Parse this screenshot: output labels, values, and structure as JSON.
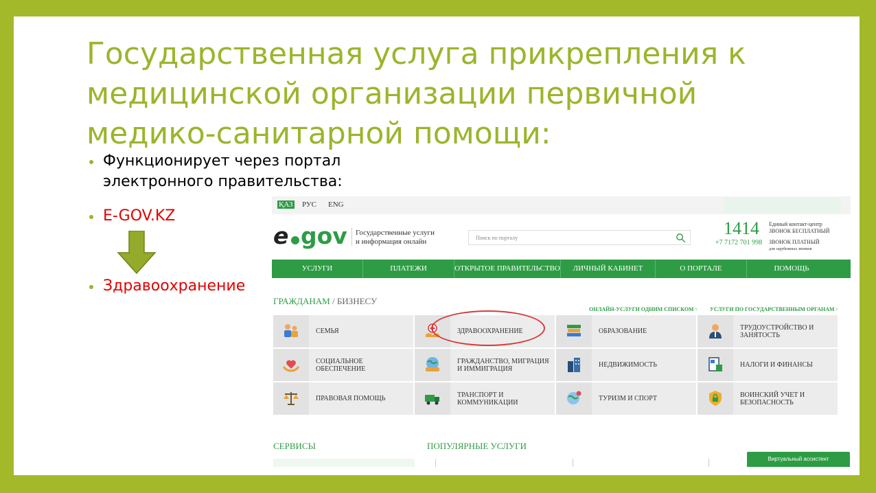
{
  "slide": {
    "title_lines": [
      "Государственная услуга прикрепления к",
      "медицинской организации первичной",
      "медико-санитарной помощи:"
    ],
    "bullets": [
      {
        "lines": [
          "Функционирует через портал",
          "электронного правительства:"
        ]
      },
      {
        "text": "E-GOV.KZ"
      },
      {
        "text": "Здравоохранение"
      }
    ]
  },
  "site": {
    "languages": [
      "ҚАЗ",
      "РУС",
      "ENG"
    ],
    "logo": {
      "e": "e",
      "gov": "gov"
    },
    "tagline": [
      "Государственные услуги",
      "и информация онлайн"
    ],
    "search_placeholder": "Поиск по порталу",
    "contact": {
      "number": "1414",
      "phone": "+7 7172 701 998",
      "line1": "Единый контакт-центр",
      "line2": "ЗВОНОК БЕСПЛАТНЫЙ",
      "line3": "ЗВОНОК ПЛАТНЫЙ",
      "line4": "для зарубежных звонков"
    },
    "nav": [
      "УСЛУГИ",
      "ПЛАТЕЖИ",
      "ОТКРЫТОЕ ПРАВИТЕЛЬСТВО",
      "ЛИЧНЫЙ КАБИНЕТ",
      "О ПОРТАЛЕ",
      "ПОМОЩЬ"
    ],
    "citizens_title": "ГРАЖДАНАМ",
    "business_title": "/ БИЗНЕСУ",
    "link_online": "ОНЛАЙН-УСЛУГИ ОДНИМ СПИСКОМ ▫",
    "link_agencies": "УСЛУГИ ПО ГОСУДАРСТВЕННЫМ ОРГАНАМ ▫",
    "categories": [
      {
        "label": "СЕМЬЯ",
        "icon": "family-icon"
      },
      {
        "label": "ЗДРАВООХРАНЕНИЕ",
        "icon": "healthcare-icon"
      },
      {
        "label": "ОБРАЗОВАНИЕ",
        "icon": "books-icon"
      },
      {
        "label": "ТРУДОУСТРОЙСТВО И ЗАНЯТОСТЬ",
        "icon": "worker-icon"
      },
      {
        "label": "СОЦИАЛЬНОЕ ОБЕСПЕЧЕНИЕ",
        "icon": "heart-hands-icon"
      },
      {
        "label": "ГРАЖДАНСТВО, МИГРАЦИЯ И ИММИГРАЦИЯ",
        "icon": "globe-people-icon"
      },
      {
        "label": "НЕДВИЖИМОСТЬ",
        "icon": "building-icon"
      },
      {
        "label": "НАЛОГИ И ФИНАНСЫ",
        "icon": "tax-document-icon"
      },
      {
        "label": "ПРАВОВАЯ ПОМОЩЬ",
        "icon": "scales-icon"
      },
      {
        "label": "ТРАНСПОРТ И КОММУНИКАЦИИ",
        "icon": "truck-icon"
      },
      {
        "label": "ТУРИЗМ И СПОРТ",
        "icon": "globe-pin-icon"
      },
      {
        "label": "ВОИНСКИЙ УЧЕТ И БЕЗОПАСНОСТЬ",
        "icon": "shield-lock-icon"
      }
    ],
    "services_title": "СЕРВИСЫ",
    "popular_title": "ПОПУЛЯРНЫЕ УСЛУГИ",
    "assistant": "Виртуальный ассистент",
    "colors": {
      "brand_green": "#2e9c45",
      "slide_green": "#9bb52c",
      "highlight_red": "#d93a3a"
    }
  }
}
